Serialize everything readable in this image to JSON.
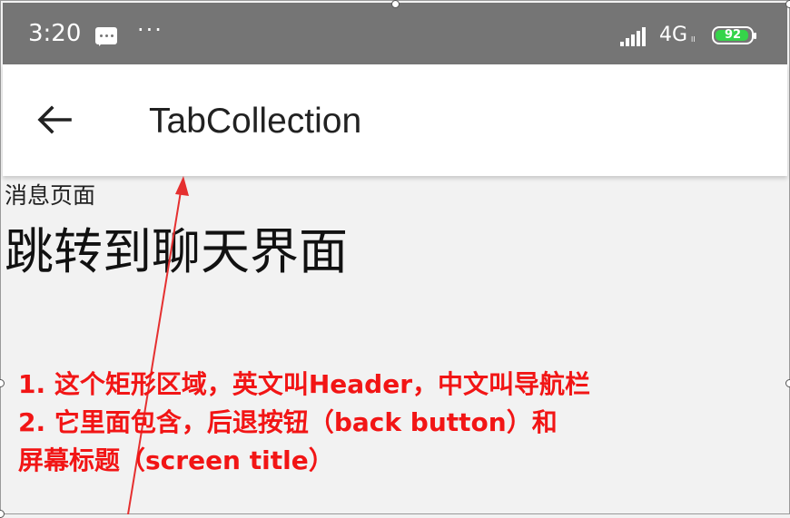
{
  "status_bar": {
    "time": "3:20",
    "message_icon": "message-icon",
    "more_dots": "···",
    "network_label": "4G",
    "network_sub": "ll",
    "battery_level": "92",
    "battery_color": "#35d44a",
    "signal_icon": "signal-icon"
  },
  "header": {
    "back_icon": "back-arrow-icon",
    "title": "TabCollection"
  },
  "content": {
    "page_label": "消息页面",
    "jump_link": "跳转到聊天界面"
  },
  "annotation": {
    "color": "#f21515",
    "line1": "1. 这个矩形区域，英文叫Header，中文叫导航栏",
    "line2": "2. 它里面包含，后退按钮（back button）和",
    "line3": "屏幕标题（screen title）"
  }
}
